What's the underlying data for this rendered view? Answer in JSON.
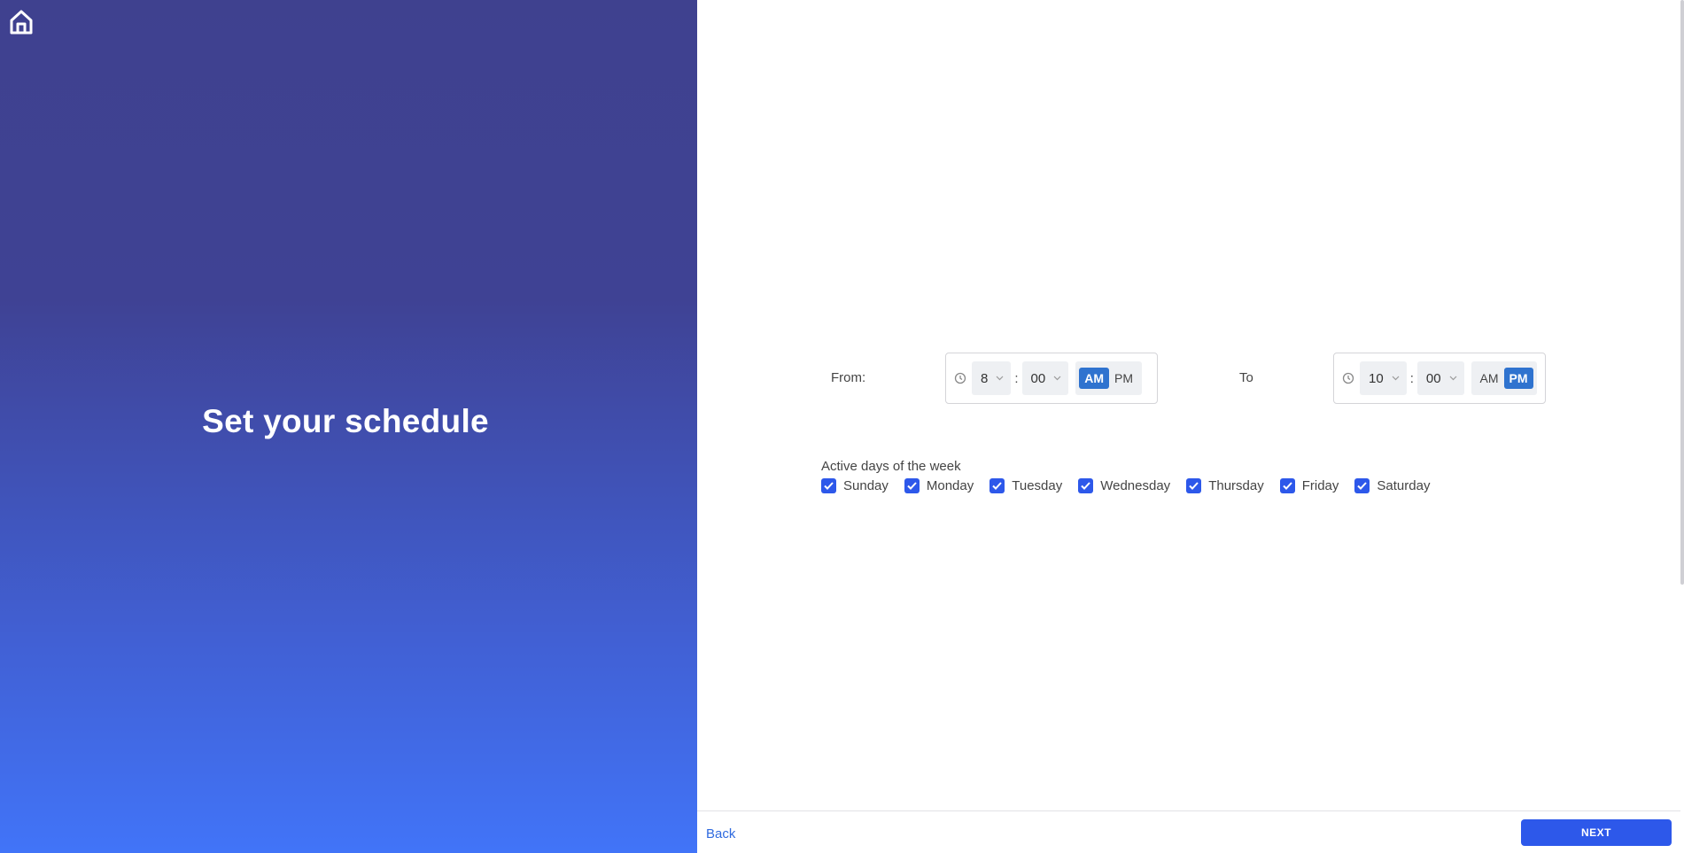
{
  "left": {
    "home_icon": "home-icon",
    "title": "Set your schedule"
  },
  "schedule": {
    "from": {
      "label": "From:",
      "hour": "8",
      "minute": "00",
      "am": "AM",
      "pm": "PM",
      "period": "AM"
    },
    "to": {
      "label": "To",
      "hour": "10",
      "minute": "00",
      "am": "AM",
      "pm": "PM",
      "period": "PM"
    },
    "separator": ":"
  },
  "days": {
    "title": "Active days of the week",
    "items": [
      {
        "label": "Sunday",
        "checked": true
      },
      {
        "label": "Monday",
        "checked": true
      },
      {
        "label": "Tuesday",
        "checked": true
      },
      {
        "label": "Wednesday",
        "checked": true
      },
      {
        "label": "Thursday",
        "checked": true
      },
      {
        "label": "Friday",
        "checked": true
      },
      {
        "label": "Saturday",
        "checked": true
      }
    ]
  },
  "footer": {
    "back_label": "Back",
    "next_label": "NEXT"
  },
  "colors": {
    "accent": "#2d58ea",
    "ampm_active": "#2f73cf",
    "gradient_top": "#3f418f",
    "gradient_bottom": "#4174f8"
  }
}
